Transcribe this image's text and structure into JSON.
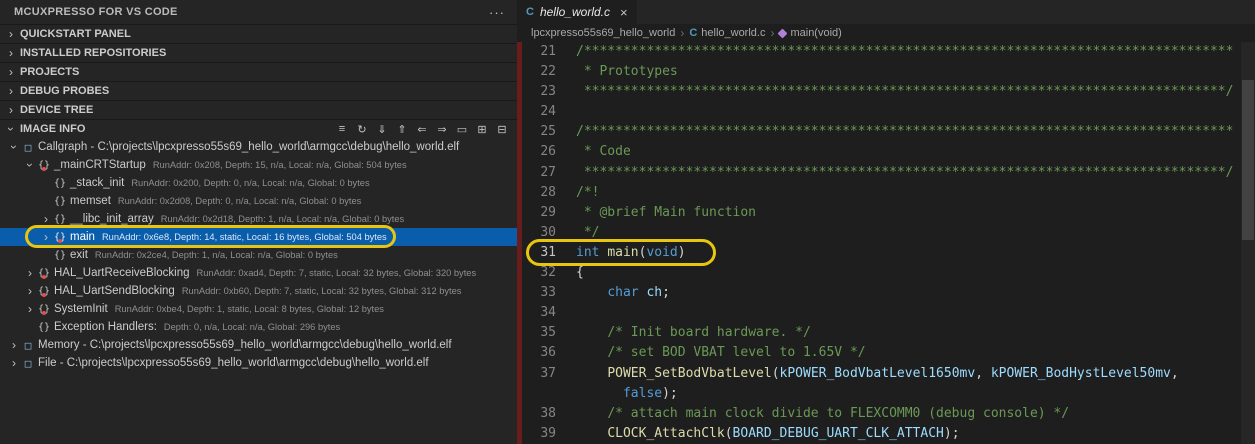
{
  "glyphs": {
    "chevron": "›",
    "more": "···",
    "close": "×",
    "separator": "›",
    "c_icon": "C",
    "braces": "{}",
    "braces-red": "{}",
    "callgraph": "□",
    "memory": "□",
    "file": "□"
  },
  "sidebar": {
    "title": "MCUXPRESSO FOR VS CODE",
    "sections": [
      {
        "id": "quickstart-panel",
        "label": "QUICKSTART PANEL"
      },
      {
        "id": "installed-repositories",
        "label": "INSTALLED REPOSITORIES"
      },
      {
        "id": "projects",
        "label": "PROJECTS"
      },
      {
        "id": "debug-probes",
        "label": "DEBUG PROBES"
      },
      {
        "id": "device-tree",
        "label": "DEVICE TREE"
      }
    ],
    "image_info": {
      "label": "IMAGE INFO",
      "toolbar": [
        {
          "name": "filter-icon",
          "glyph": "≡"
        },
        {
          "name": "refresh-icon",
          "glyph": "↻"
        },
        {
          "name": "save-data-icon",
          "glyph": "⇓"
        },
        {
          "name": "export-data-icon",
          "glyph": "⇑"
        },
        {
          "name": "import-data-icon",
          "glyph": "⇐"
        },
        {
          "name": "share-data-icon",
          "glyph": "⇒"
        },
        {
          "name": "open-report-icon",
          "glyph": "▭"
        },
        {
          "name": "expand-all-icon",
          "glyph": "⊞"
        },
        {
          "name": "collapse-all-icon",
          "glyph": "⊟"
        }
      ],
      "tree": [
        {
          "id": "callgraph",
          "indent": 0,
          "chevron": "down",
          "icon": "callgraph",
          "name": "Callgraph - C:\\projects\\lpcxpresso55s69_hello_world\\armgcc\\debug\\hello_world.elf",
          "detail": ""
        },
        {
          "id": "maincrtstartup",
          "indent": 1,
          "chevron": "down",
          "icon": "braces-red",
          "name": "_mainCRTStartup",
          "detail": "RunAddr: 0x208, Depth: 15, n/a, Local: n/a, Global: 504 bytes"
        },
        {
          "id": "stack-init",
          "indent": 2,
          "chevron": "none",
          "icon": "braces",
          "name": "_stack_init",
          "detail": "RunAddr: 0x200, Depth: 0, n/a, Local: n/a, Global: 0 bytes"
        },
        {
          "id": "memset",
          "indent": 2,
          "chevron": "none",
          "icon": "braces",
          "name": "memset",
          "detail": "RunAddr: 0x2d08, Depth: 0, n/a, Local: n/a, Global: 0 bytes"
        },
        {
          "id": "libc-init-array",
          "indent": 2,
          "chevron": "right",
          "icon": "braces",
          "name": "__libc_init_array",
          "detail": "RunAddr: 0x2d18, Depth: 1, n/a, Local: n/a, Global: 0 bytes"
        },
        {
          "id": "main",
          "indent": 2,
          "chevron": "right",
          "icon": "braces-red",
          "name": "main",
          "detail": "RunAddr: 0x6e8, Depth: 14, static, Local: 16 bytes, Global: 504 bytes",
          "selected": true
        },
        {
          "id": "exit",
          "indent": 2,
          "chevron": "none",
          "icon": "braces",
          "name": "exit",
          "detail": "RunAddr: 0x2ce4, Depth: 1, n/a, Local: n/a, Global: 0 bytes"
        },
        {
          "id": "hal-uart-receive-blocking",
          "indent": 1,
          "chevron": "right",
          "icon": "braces-red",
          "name": "HAL_UartReceiveBlocking",
          "detail": "RunAddr: 0xad4, Depth: 7, static, Local: 32 bytes, Global: 320 bytes"
        },
        {
          "id": "hal-uart-send-blocking",
          "indent": 1,
          "chevron": "right",
          "icon": "braces-red",
          "name": "HAL_UartSendBlocking",
          "detail": "RunAddr: 0xb60, Depth: 7, static, Local: 32 bytes, Global: 312 bytes"
        },
        {
          "id": "systeminit",
          "indent": 1,
          "chevron": "right",
          "icon": "braces-red",
          "name": "SystemInit",
          "detail": "RunAddr: 0xbe4, Depth: 1, static, Local: 8 bytes, Global: 12 bytes"
        },
        {
          "id": "exception-handlers",
          "indent": 1,
          "chevron": "none",
          "icon": "braces",
          "name": "Exception Handlers:",
          "detail": "Depth: 0, n/a, Local: n/a, Global: 296 bytes"
        },
        {
          "id": "memory",
          "indent": 0,
          "chevron": "right",
          "icon": "memory",
          "name": "Memory - C:\\projects\\lpcxpresso55s69_hello_world\\armgcc\\debug\\hello_world.elf",
          "detail": ""
        },
        {
          "id": "file",
          "indent": 0,
          "chevron": "right",
          "icon": "file",
          "name": "File - C:\\projects\\lpcxpresso55s69_hello_world\\armgcc\\debug\\hello_world.elf",
          "detail": ""
        }
      ]
    }
  },
  "editor": {
    "tab": {
      "label": "hello_world.c"
    },
    "breadcrumb": {
      "items": [
        {
          "id": "project",
          "label": "lpcxpresso55s69_hello_world",
          "icon": null
        },
        {
          "id": "file",
          "label": "hello_world.c",
          "icon": "c"
        },
        {
          "id": "symbol",
          "label": "main(void)",
          "icon": "method"
        }
      ]
    },
    "code": {
      "lines": [
        {
          "num": "21",
          "tokens": [
            {
              "t": "comment",
              "s": "/***********************************************************************************"
            }
          ]
        },
        {
          "num": "22",
          "tokens": [
            {
              "t": "comment",
              "s": " * Prototypes"
            }
          ]
        },
        {
          "num": "23",
          "tokens": [
            {
              "t": "comment",
              "s": " **********************************************************************************/"
            }
          ]
        },
        {
          "num": "24",
          "tokens": []
        },
        {
          "num": "25",
          "tokens": [
            {
              "t": "comment",
              "s": "/***********************************************************************************"
            }
          ]
        },
        {
          "num": "26",
          "tokens": [
            {
              "t": "comment",
              "s": " * Code"
            }
          ]
        },
        {
          "num": "27",
          "tokens": [
            {
              "t": "comment",
              "s": " **********************************************************************************/"
            }
          ]
        },
        {
          "num": "28",
          "tokens": [
            {
              "t": "comment",
              "s": "/*!"
            }
          ]
        },
        {
          "num": "29",
          "tokens": [
            {
              "t": "comment",
              "s": " * @brief Main function"
            }
          ]
        },
        {
          "num": "30",
          "tokens": [
            {
              "t": "comment",
              "s": " */"
            }
          ]
        },
        {
          "num": "31",
          "active": true,
          "tokens": [
            {
              "t": "keyword",
              "s": "int"
            },
            {
              "t": "plain",
              "s": " "
            },
            {
              "t": "function",
              "s": "main"
            },
            {
              "t": "plain",
              "s": "("
            },
            {
              "t": "keyword",
              "s": "void"
            },
            {
              "t": "plain",
              "s": ")"
            }
          ]
        },
        {
          "num": "32",
          "tokens": [
            {
              "t": "plain",
              "s": "{"
            }
          ]
        },
        {
          "num": "33",
          "tokens": [
            {
              "t": "plain",
              "s": "    "
            },
            {
              "t": "keyword",
              "s": "char"
            },
            {
              "t": "plain",
              "s": " "
            },
            {
              "t": "variable",
              "s": "ch"
            },
            {
              "t": "plain",
              "s": ";"
            }
          ]
        },
        {
          "num": "34",
          "tokens": []
        },
        {
          "num": "35",
          "tokens": [
            {
              "t": "plain",
              "s": "    "
            },
            {
              "t": "comment",
              "s": "/* Init board hardware. */"
            }
          ]
        },
        {
          "num": "36",
          "tokens": [
            {
              "t": "plain",
              "s": "    "
            },
            {
              "t": "comment",
              "s": "/* set BOD VBAT level to 1.65V */"
            }
          ]
        },
        {
          "num": "37",
          "tokens": [
            {
              "t": "plain",
              "s": "    "
            },
            {
              "t": "function",
              "s": "POWER_SetBodVbatLevel"
            },
            {
              "t": "plain",
              "s": "("
            },
            {
              "t": "variable",
              "s": "kPOWER_BodVbatLevel1650mv"
            },
            {
              "t": "plain",
              "s": ", "
            },
            {
              "t": "variable",
              "s": "kPOWER_BodHystLevel50mv"
            },
            {
              "t": "plain",
              "s": ","
            }
          ]
        },
        {
          "num": "",
          "tokens": [
            {
              "t": "plain",
              "s": "      "
            },
            {
              "t": "keyword",
              "s": "false"
            },
            {
              "t": "plain",
              "s": ");"
            }
          ]
        },
        {
          "num": "38",
          "tokens": [
            {
              "t": "plain",
              "s": "    "
            },
            {
              "t": "comment",
              "s": "/* attach main clock divide to FLEXCOMM0 (debug console) */"
            }
          ]
        },
        {
          "num": "39",
          "tokens": [
            {
              "t": "plain",
              "s": "    "
            },
            {
              "t": "function",
              "s": "CLOCK_AttachClk"
            },
            {
              "t": "plain",
              "s": "("
            },
            {
              "t": "variable",
              "s": "BOARD_DEBUG_UART_CLK_ATTACH"
            },
            {
              "t": "plain",
              "s": ");"
            }
          ]
        }
      ]
    }
  }
}
